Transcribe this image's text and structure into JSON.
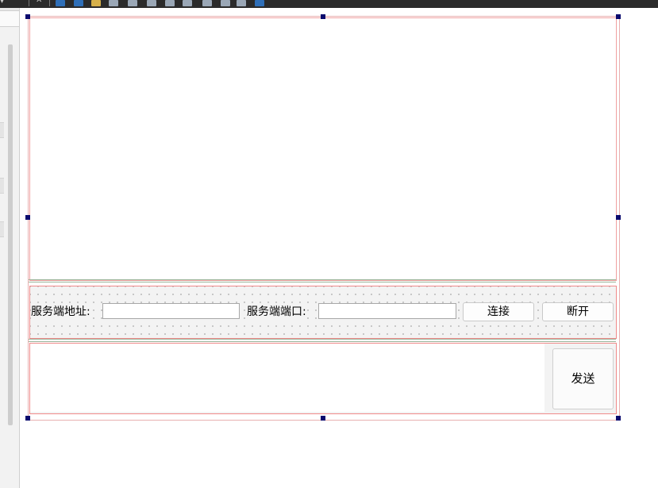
{
  "form": {
    "server_address_label": "服务端地址:",
    "server_address_value": "",
    "server_port_label": "服务端端口:",
    "server_port_value": "",
    "connect_label": "连接",
    "disconnect_label": "断开",
    "message_value": "",
    "send_label": "发送"
  }
}
